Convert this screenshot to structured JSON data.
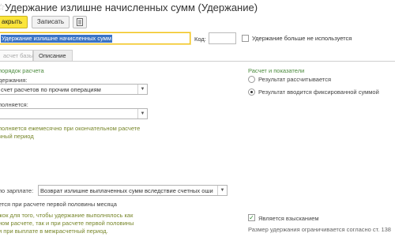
{
  "window": {
    "title": "Удержание излишне начисленных сумм (Удержание)"
  },
  "toolbar": {
    "primary_label": "акрыть",
    "record_label": "Записать",
    "doc_icon": "document-list-icon"
  },
  "header": {
    "name_value": "Удержание излишне начисленных сумм",
    "code_label": "Код:",
    "code_value": "",
    "not_used_label": "Удержание больше не используется",
    "not_used_checked": false
  },
  "tabs": [
    {
      "label": "асчет базы",
      "active": false
    },
    {
      "label": "Описание",
      "active": true
    }
  ],
  "left": {
    "section_title": "порядок расчета",
    "deduction_label": "держания:",
    "deduction_value": "счет расчетов по прочим операциям",
    "performed_label": "полняется:",
    "performed_value": "",
    "hint_lines": [
      "полняется ежемесячно при окончательном расчете",
      "чный период"
    ],
    "salary_label": "по зарплате:",
    "salary_value": "Возврат излишне выплаченных сумм вследствие счетных оши",
    "first_half_label": "ется при расчете первой половины месяца",
    "first_half_hint_lines": [
      "жок для того, чтобы удержание выполнялось как",
      "ном расчете, так и при расчете первой половины",
      "и при выплате в межрасчетный период."
    ]
  },
  "right": {
    "section_title": "Расчет и показатели",
    "options": [
      {
        "label": "Результат рассчитывается",
        "selected": false
      },
      {
        "label": "Результат вводится фиксированной суммой",
        "selected": true
      }
    ],
    "collection_label": "Является взысканием",
    "collection_checked": true,
    "limit_text": "Размер удержания ограничивается согласно ст. 138"
  },
  "colors": {
    "accent_yellow": "#fbe53a",
    "selection_blue": "#3a73c6",
    "section_green": "#4a8a3c",
    "hint_olive": "#77862a"
  }
}
